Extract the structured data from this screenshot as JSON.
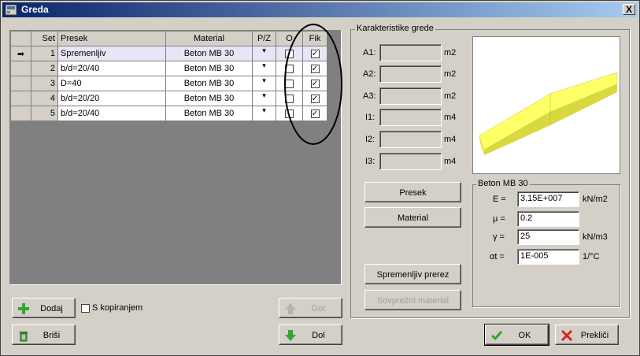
{
  "window": {
    "title": "Greda",
    "close_label": "X"
  },
  "table": {
    "headers": [
      "Set",
      "Presek",
      "Material",
      "P/Z",
      "O",
      "Fik"
    ],
    "selected_marker": "➡",
    "rows": [
      {
        "set": "1",
        "presek": "Spremenljiv",
        "material": "Beton MB 30",
        "pz": "▾",
        "o": "",
        "fik": "✓"
      },
      {
        "set": "2",
        "presek": "b/d=20/40",
        "material": "Beton MB 30",
        "pz": "▾",
        "o": "",
        "fik": "✓"
      },
      {
        "set": "3",
        "presek": "D=40",
        "material": "Beton MB 30",
        "pz": "▾",
        "o": "",
        "fik": "✓"
      },
      {
        "set": "4",
        "presek": "b/d=20/20",
        "material": "Beton MB 30",
        "pz": "▾",
        "o": "",
        "fik": "✓"
      },
      {
        "set": "5",
        "presek": "b/d=20/40",
        "material": "Beton MB 30",
        "pz": "▾",
        "o": "",
        "fik": "✓"
      }
    ]
  },
  "buttons": {
    "dodaj": "Dodaj",
    "brisi": "Briši",
    "gor": "Gor",
    "dol": "Dol",
    "presek": "Presek",
    "material": "Material",
    "spremenljiv_prerez": "Spremenljiv prerez",
    "sovprezni_material": "Sovprežni material",
    "ok": "OK",
    "preklici": "Prekliči"
  },
  "kopiranjem_label": "S kopiranjem",
  "karakteristike": {
    "title": "Karakteristike grede",
    "rows": [
      {
        "label": "A1:",
        "unit": "m2"
      },
      {
        "label": "A2:",
        "unit": "m2"
      },
      {
        "label": "A3:",
        "unit": "m2"
      },
      {
        "label": "I1:",
        "unit": "m4"
      },
      {
        "label": "I2:",
        "unit": "m4"
      },
      {
        "label": "I3:",
        "unit": "m4"
      }
    ]
  },
  "material_props": {
    "title": "Beton MB 30",
    "E": {
      "label": "E =",
      "value": "3.15E+007",
      "unit": "kN/m2"
    },
    "mu": {
      "label": "μ =",
      "value": "0.2",
      "unit": ""
    },
    "gamma": {
      "label": "γ =",
      "value": "25",
      "unit": "kN/m3"
    },
    "alpha": {
      "label": "αt =",
      "value": "1E-005",
      "unit": "1/°C"
    }
  },
  "colors": {
    "title_start": "#0a246a",
    "title_end": "#a6caf0",
    "beam": "#ffff66"
  },
  "icons": [
    "app-icon",
    "plus-icon",
    "trash-icon",
    "arrow-up-icon",
    "arrow-down-icon",
    "check-icon",
    "x-icon"
  ]
}
